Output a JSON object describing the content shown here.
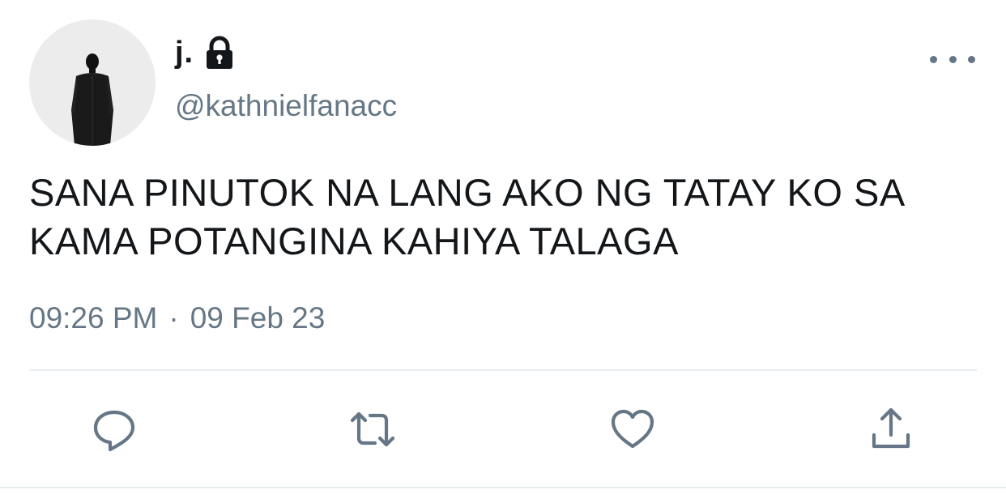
{
  "user": {
    "display_name": "j.",
    "handle": "@kathnielfanacc",
    "protected_icon": "lock-icon",
    "avatar_icon": "person-silhouette"
  },
  "tweet": {
    "text": "SANA PINUTOK NA LANG AKO NG TATAY KO SA KAMA POTANGINA KAHIYA TALAGA",
    "time": "09:26 PM",
    "separator": "·",
    "date": "09 Feb 23"
  },
  "actions": [
    {
      "name": "reply",
      "icon": "reply-icon"
    },
    {
      "name": "retweet",
      "icon": "retweet-icon"
    },
    {
      "name": "like",
      "icon": "heart-icon"
    },
    {
      "name": "share",
      "icon": "share-icon"
    }
  ],
  "colors": {
    "text_primary": "#14171a",
    "text_secondary": "#657786",
    "divider": "#e6ecf0",
    "avatar_bg": "#ececec"
  }
}
